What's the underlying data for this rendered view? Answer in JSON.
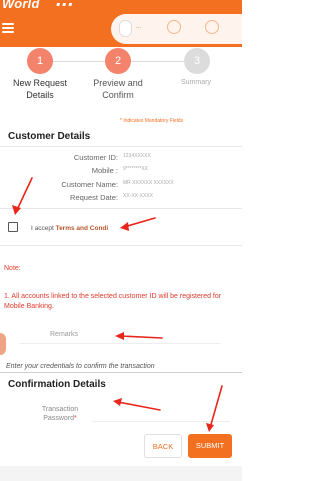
{
  "header": {
    "brand_left": "World",
    "brand_right": "...",
    "pill_label": "...",
    "accent": "#f37021"
  },
  "stepper": {
    "steps": [
      {
        "number": "1",
        "label": "New Request Details"
      },
      {
        "number": "2",
        "label": "Preview and Confirm"
      },
      {
        "number": "3",
        "label": "Summary"
      }
    ]
  },
  "mandatory_note": "* Indicates Mandatory Fields",
  "customer_details": {
    "title": "Customer Details",
    "rows": [
      {
        "label": "Customer ID:",
        "value": "1234XXXXX"
      },
      {
        "label": "Mobile :",
        "value": "9********XX"
      },
      {
        "label": "Customer Name:",
        "value": "MR XXXXXX XXXXXX"
      },
      {
        "label": "Request Date:",
        "value": "XX-XX-XXXX"
      }
    ]
  },
  "terms": {
    "prefix": "I accept ",
    "link": "Terms and Condi"
  },
  "note": {
    "title": "Note:",
    "text": "1. All accounts linked to the selected customer ID will be registered for Mobile Banking."
  },
  "remarks_placeholder": "Remarks",
  "credentials_text": "Enter your credentials to confirm the transaction",
  "confirmation": {
    "title": "Confirmation Details",
    "field_label": "Transaction Password",
    "required_mark": "*"
  },
  "buttons": {
    "back": "BACK",
    "submit": "SUBMIT"
  },
  "colors": {
    "arrow": "#e8261c",
    "note": "#e23a2c"
  }
}
